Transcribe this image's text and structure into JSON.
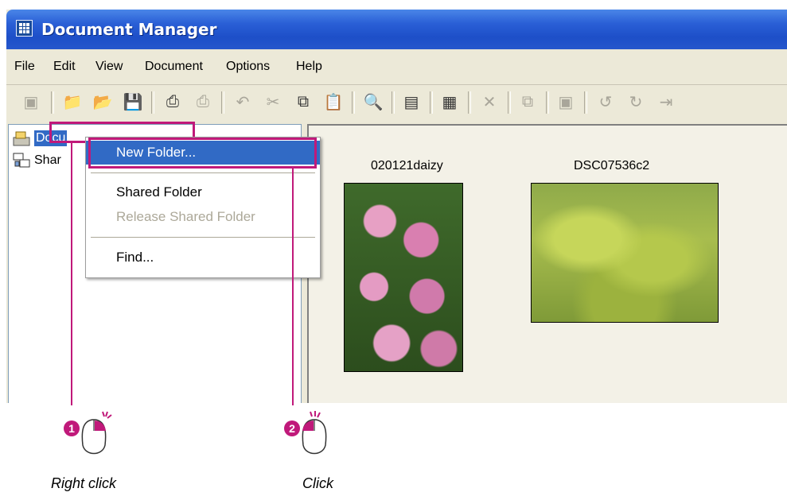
{
  "window": {
    "title": "Document Manager"
  },
  "menubar": {
    "items": [
      "File",
      "Edit",
      "View",
      "Document",
      "Options",
      "Help"
    ]
  },
  "tree": {
    "items": [
      {
        "label": "Docu"
      },
      {
        "label": "Shar"
      }
    ]
  },
  "thumbnails": [
    {
      "label": "020121daizy"
    },
    {
      "label": "DSC07536c2"
    }
  ],
  "context_menu": {
    "new_folder": "New Folder...",
    "shared_folder": "Shared Folder",
    "release_shared_folder": "Release Shared Folder",
    "find": "Find..."
  },
  "annotations": {
    "step1_num": "1",
    "step1_caption": "Right click",
    "step2_num": "2",
    "step2_caption": "Click"
  },
  "colors": {
    "accent": "#c0197a",
    "selection": "#316ac5",
    "titlebar": "#2a5fd6"
  }
}
